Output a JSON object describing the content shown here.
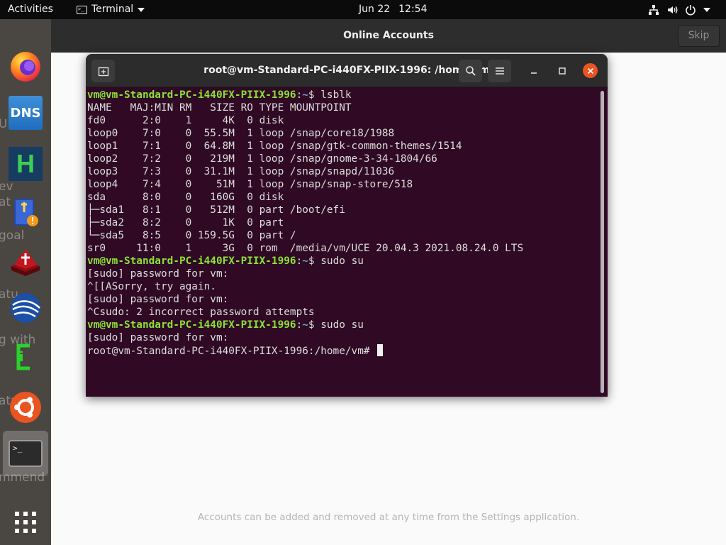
{
  "topbar": {
    "activities": "Activities",
    "app_menu": "Terminal",
    "date": "Jun 22",
    "time": "12:54"
  },
  "dock": {
    "dns_label": "DNS",
    "hb_label": "H",
    "terminal_prompt": ">_"
  },
  "online_accounts": {
    "title": "Online Accounts",
    "skip_label": "Skip",
    "hint": "Accounts can be added and removed at any time from the Settings application."
  },
  "terminal": {
    "title": "root@vm-Standard-PC-i440FX-PIIX-1996: /home/vm",
    "prompt_user": "vm@vm-Standard-PC-i440FX-PIIX-1996",
    "prompt_path": "~",
    "lines": [
      {
        "type": "prompt",
        "cmd": " lsblk"
      },
      {
        "type": "out",
        "text": "NAME   MAJ:MIN RM   SIZE RO TYPE MOUNTPOINT"
      },
      {
        "type": "out",
        "text": "fd0      2:0    1     4K  0 disk"
      },
      {
        "type": "out",
        "text": "loop0    7:0    0  55.5M  1 loop /snap/core18/1988"
      },
      {
        "type": "out",
        "text": "loop1    7:1    0  64.8M  1 loop /snap/gtk-common-themes/1514"
      },
      {
        "type": "out",
        "text": "loop2    7:2    0   219M  1 loop /snap/gnome-3-34-1804/66"
      },
      {
        "type": "out",
        "text": "loop3    7:3    0  31.1M  1 loop /snap/snapd/11036"
      },
      {
        "type": "out",
        "text": "loop4    7:4    0    51M  1 loop /snap/snap-store/518"
      },
      {
        "type": "out",
        "text": "sda      8:0    0   160G  0 disk"
      },
      {
        "type": "out",
        "text": "├─sda1   8:1    0   512M  0 part /boot/efi"
      },
      {
        "type": "out",
        "text": "├─sda2   8:2    0     1K  0 part"
      },
      {
        "type": "out",
        "text": "└─sda5   8:5    0 159.5G  0 part /"
      },
      {
        "type": "out",
        "text": "sr0     11:0    1     3G  0 rom  /media/vm/UCE 20.04.3 2021.08.24.0 LTS"
      },
      {
        "type": "prompt",
        "cmd": " sudo su"
      },
      {
        "type": "out",
        "text": "[sudo] password for vm:"
      },
      {
        "type": "out",
        "text": "^[[ASorry, try again."
      },
      {
        "type": "out",
        "text": "[sudo] password for vm:"
      },
      {
        "type": "out",
        "text": "^Csudo: 2 incorrect password attempts"
      },
      {
        "type": "prompt",
        "cmd": " sudo su"
      },
      {
        "type": "out",
        "text": "[sudo] password for vm:"
      },
      {
        "type": "root",
        "text": "root@vm-Standard-PC-i440FX-PIIX-1996:/home/vm# "
      }
    ]
  },
  "colors": {
    "terminal_bg": "#300a24",
    "prompt_user": "#8ae234",
    "prompt_path": "#729fcf",
    "close_button": "#e95420"
  }
}
